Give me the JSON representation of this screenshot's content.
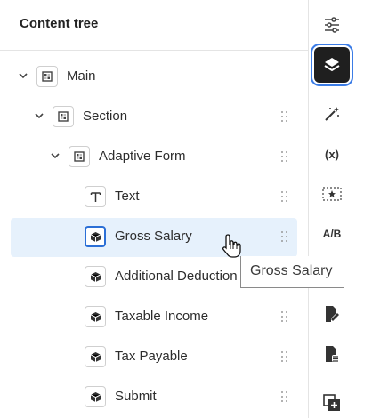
{
  "panel": {
    "title": "Content tree"
  },
  "tree": [
    {
      "label": "Main",
      "icon": "container-icon",
      "expanded": true,
      "selected": false
    },
    {
      "label": "Section",
      "icon": "container-icon",
      "expanded": true,
      "selected": false
    },
    {
      "label": "Adaptive Form",
      "icon": "container-icon",
      "expanded": true,
      "selected": false
    },
    {
      "label": "Text",
      "icon": "text-type-icon",
      "selected": false
    },
    {
      "label": "Gross Salary",
      "icon": "box-icon",
      "selected": true
    },
    {
      "label": "Additional Deduction",
      "icon": "box-icon",
      "selected": false
    },
    {
      "label": "Taxable Income",
      "icon": "box-icon",
      "selected": false
    },
    {
      "label": "Tax Payable",
      "icon": "box-icon",
      "selected": false
    },
    {
      "label": "Submit",
      "icon": "box-icon",
      "selected": false
    }
  ],
  "tooltip": {
    "text": "Gross Salary"
  },
  "rail": {
    "items": [
      {
        "name": "properties-sliders-icon"
      },
      {
        "name": "layers-icon",
        "active": true
      },
      {
        "name": "magic-wand-icon"
      },
      {
        "name": "variable-icon",
        "label": "(x)"
      },
      {
        "name": "star-field-icon"
      },
      {
        "name": "ab-test-icon",
        "label": "A/B"
      },
      {
        "name": "edit-document-icon"
      },
      {
        "name": "data-document-icon"
      },
      {
        "name": "add-copy-icon"
      }
    ]
  },
  "colors": {
    "selected_bg": "#e6f1fc",
    "accent": "#2b6fd6",
    "active_rail": "#1f1f1f"
  }
}
